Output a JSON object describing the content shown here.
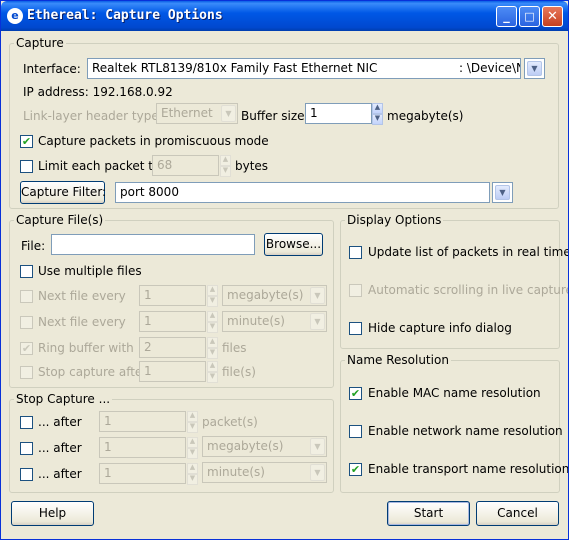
{
  "window": {
    "title": "Ethereal: Capture Options",
    "icon": "ethereal-app-icon",
    "controls": {
      "minimize": "_",
      "maximize": "□",
      "close": "✕"
    }
  },
  "capture": {
    "group_title": "Capture",
    "interface_label": "Interface:",
    "interface_value": "Realtek RTL8139/810x Family Fast Ethernet NIC",
    "interface_device": ": \\Device\\NPF_",
    "ip_address": "IP address: 192.168.0.92",
    "link_layer_label": "Link-layer header type:",
    "link_layer_value": "Ethernet",
    "buffer_size_label": "Buffer size:",
    "buffer_size_value": "1",
    "buffer_size_unit": "megabyte(s)",
    "promiscuous": {
      "label": "Capture packets in promiscuous mode",
      "checked": true
    },
    "limit_packet": {
      "label": "Limit each packet to",
      "value": "68",
      "unit": "bytes",
      "checked": false
    },
    "filter_button": "Capture Filter:",
    "filter_value": "port 8000"
  },
  "capture_files": {
    "group_title": "Capture File(s)",
    "file_label": "File:",
    "file_value": "",
    "browse_button": "Browse...",
    "use_multiple_files": {
      "label": "Use multiple files",
      "checked": false
    },
    "next_file_size": {
      "label": "Next file every",
      "value": "1",
      "unit": "megabyte(s)"
    },
    "next_file_time": {
      "label": "Next file every",
      "value": "1",
      "unit": "minute(s)"
    },
    "ring_buffer": {
      "label": "Ring buffer with",
      "value": "2",
      "unit": "files"
    },
    "stop_after": {
      "label": "Stop capture after",
      "value": "1",
      "unit": "file(s)"
    }
  },
  "stop_capture": {
    "group_title": "Stop Capture ...",
    "rows": [
      {
        "label": "... after",
        "value": "1",
        "unit": "packet(s)"
      },
      {
        "label": "... after",
        "value": "1",
        "unit": "megabyte(s)"
      },
      {
        "label": "... after",
        "value": "1",
        "unit": "minute(s)"
      }
    ]
  },
  "display_options": {
    "group_title": "Display Options",
    "update_realtime": {
      "label": "Update list of packets in real time",
      "checked": false
    },
    "auto_scroll": {
      "label": "Automatic scrolling in live capture",
      "checked": false
    },
    "hide_info": {
      "label": "Hide capture info dialog",
      "checked": false
    }
  },
  "name_resolution": {
    "group_title": "Name Resolution",
    "mac": {
      "label": "Enable MAC name resolution",
      "checked": true
    },
    "network": {
      "label": "Enable network name resolution",
      "checked": false
    },
    "transport": {
      "label": "Enable transport name resolution",
      "checked": true
    }
  },
  "buttons": {
    "help": "Help",
    "start": "Start",
    "cancel": "Cancel"
  },
  "colors": {
    "title_bar": "#0054e3",
    "dialog_bg": "#ece9d8",
    "check_mark": "#21a121"
  }
}
